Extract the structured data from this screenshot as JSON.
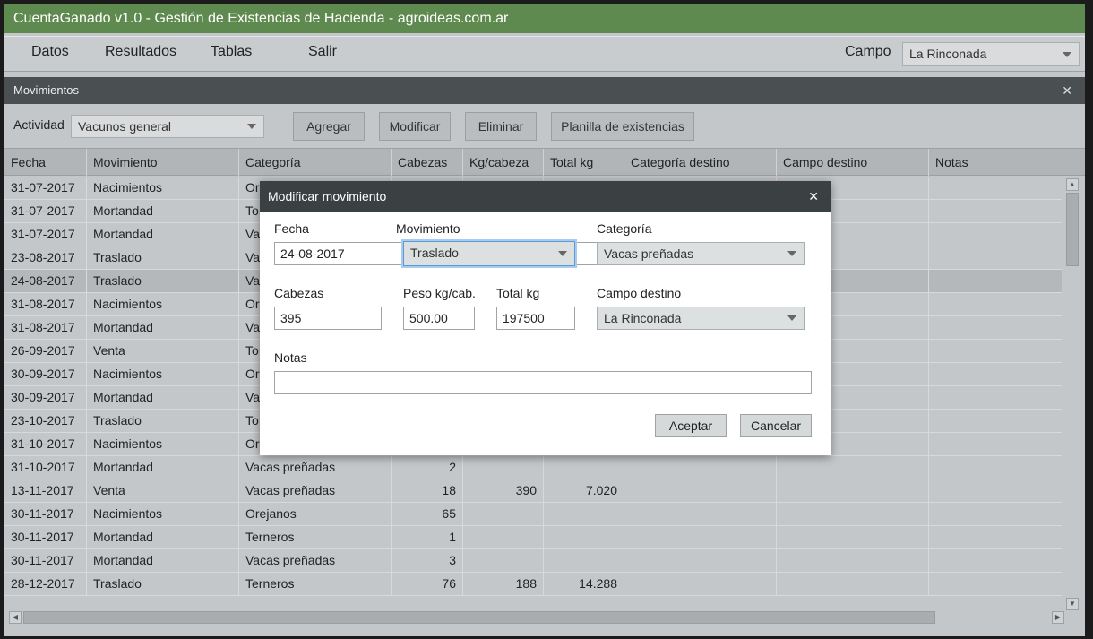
{
  "app": {
    "title": "CuentaGanado v1.0 - Gestión de Existencias de Hacienda - agroideas.com.ar"
  },
  "menu": {
    "items": [
      "Datos",
      "Resultados",
      "Tablas",
      "Salir"
    ],
    "campo_label": "Campo",
    "campo_value": "La Rinconada"
  },
  "panel": {
    "title": "Movimientos",
    "actividad_label": "Actividad",
    "actividad_value": "Vacunos general",
    "buttons": {
      "agregar": "Agregar",
      "modificar": "Modificar",
      "eliminar": "Eliminar",
      "planilla": "Planilla de existencias"
    }
  },
  "table": {
    "columns": [
      "Fecha",
      "Movimiento",
      "Categoría",
      "Cabezas",
      "Kg/cabeza",
      "Total kg",
      "Categoría destino",
      "Campo destino",
      "Notas"
    ],
    "rows": [
      [
        "31-07-2017",
        "Nacimientos",
        "Or",
        "",
        "",
        "",
        "",
        "",
        ""
      ],
      [
        "31-07-2017",
        "Mortandad",
        "To",
        "",
        "",
        "",
        "",
        "",
        ""
      ],
      [
        "31-07-2017",
        "Mortandad",
        "Va",
        "",
        "",
        "",
        "",
        "",
        ""
      ],
      [
        "23-08-2017",
        "Traslado",
        "Va",
        "",
        "",
        "",
        "",
        "",
        ""
      ],
      [
        "24-08-2017",
        "Traslado",
        "Va",
        "",
        "",
        "",
        "",
        "",
        ""
      ],
      [
        "31-08-2017",
        "Nacimientos",
        "Or",
        "",
        "",
        "",
        "",
        "",
        ""
      ],
      [
        "31-08-2017",
        "Mortandad",
        "Va",
        "",
        "",
        "",
        "",
        "",
        ""
      ],
      [
        "26-09-2017",
        "Venta",
        "To",
        "",
        "",
        "",
        "",
        "",
        ""
      ],
      [
        "30-09-2017",
        "Nacimientos",
        "Or",
        "",
        "",
        "",
        "",
        "",
        ""
      ],
      [
        "30-09-2017",
        "Mortandad",
        "Va",
        "",
        "",
        "",
        "",
        "",
        ""
      ],
      [
        "23-10-2017",
        "Traslado",
        "To",
        "",
        "",
        "",
        "",
        "",
        ""
      ],
      [
        "31-10-2017",
        "Nacimientos",
        "Or",
        "",
        "",
        "",
        "",
        "",
        ""
      ],
      [
        "31-10-2017",
        "Mortandad",
        "Vacas preñadas",
        "2",
        "",
        "",
        "",
        "",
        ""
      ],
      [
        "13-11-2017",
        "Venta",
        "Vacas preñadas",
        "18",
        "390",
        "7.020",
        "",
        "",
        ""
      ],
      [
        "30-11-2017",
        "Nacimientos",
        "Orejanos",
        "65",
        "",
        "",
        "",
        "",
        ""
      ],
      [
        "30-11-2017",
        "Mortandad",
        "Terneros",
        "1",
        "",
        "",
        "",
        "",
        ""
      ],
      [
        "30-11-2017",
        "Mortandad",
        "Vacas preñadas",
        "3",
        "",
        "",
        "",
        "",
        ""
      ],
      [
        "28-12-2017",
        "Traslado",
        "Terneros",
        "76",
        "188",
        "14.288",
        "",
        "",
        ""
      ]
    ],
    "selected_row": 4
  },
  "modal": {
    "title": "Modificar movimiento",
    "fecha_label": "Fecha",
    "fecha_value": "24-08-2017",
    "movimiento_label": "Movimiento",
    "movimiento_value": "Traslado",
    "categoria_label": "Categoría",
    "categoria_value": "Vacas preñadas",
    "cabezas_label": "Cabezas",
    "cabezas_value": "395",
    "peso_label": "Peso kg/cab.",
    "peso_value": "500.00",
    "total_label": "Total kg",
    "total_value": "197500",
    "campo_destino_label": "Campo destino",
    "campo_destino_value": "La Rinconada",
    "notas_label": "Notas",
    "notas_value": "",
    "aceptar": "Aceptar",
    "cancelar": "Cancelar"
  },
  "icons": {
    "close": "close-icon",
    "calendar": "calendar-icon",
    "dropdown": "chevron-down-icon"
  }
}
